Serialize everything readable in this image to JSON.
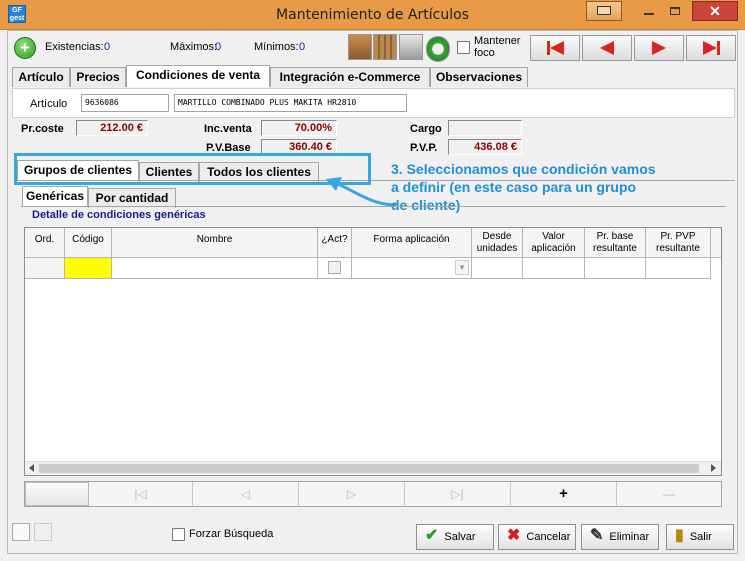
{
  "window": {
    "title": "Mantenimiento de Artículos",
    "app_icon_text": "GF gest",
    "close_symbol": "✕"
  },
  "toolbar": {
    "existencias_label": "Existencias:",
    "existencias_value": "0",
    "maximos_label": "Máximos:",
    "maximos_value": "0",
    "minimos_label": "Mínimos:",
    "minimos_value": "0",
    "mantener_foco_label_1": "Mantener",
    "mantener_foco_label_2": "foco",
    "icons": [
      "add-icon",
      "boxes-icon",
      "shelf-icon",
      "calculator-icon",
      "refresh-icon",
      "first-record-icon",
      "previous-record-icon",
      "next-record-icon",
      "last-record-icon"
    ]
  },
  "main_tabs": [
    "Artículo",
    "Precios",
    "Condiciones de venta",
    "Integración e-Commerce",
    "Observaciones"
  ],
  "active_main_tab": "Condiciones de venta",
  "articulo": {
    "label": "Artículo",
    "code": "9636086",
    "description": "MARTILLO COMBINADO PLUS MAKITA HR2810"
  },
  "prices": {
    "prcoste_label": "Pr.coste",
    "prcoste_value": "212.00 €",
    "incventa_label": "Inc.venta",
    "incventa_value": "70.00%",
    "pvbase_label": "P.V.Base",
    "pvbase_value": "360.40 €",
    "cargo_label": "Cargo",
    "cargo_value": "",
    "pvp_label": "P.V.P.",
    "pvp_value": "436.08 €"
  },
  "condition_tabs": [
    "Grupos de clientes",
    "Clientes",
    "Todos los clientes"
  ],
  "annotation": "3. Seleccionamos que condición vamos a definir (en este caso para un grupo de cliente)",
  "sub_tabs": [
    "Genéricas",
    "Por cantidad"
  ],
  "group_title": "Detalle de condiciones genéricas",
  "grid": {
    "columns": [
      "Ord.",
      "Código",
      "Nombre",
      "¿Act?",
      "Forma aplicación",
      "Desde unidades",
      "Valor aplicación",
      "Pr. base resultante",
      "Pr. PVP resultante"
    ]
  },
  "navigator": {
    "buttons": [
      "first-icon",
      "prior-icon",
      "next-icon",
      "last-icon",
      "insert-icon",
      "delete-icon"
    ],
    "insert_symbol": "+"
  },
  "footer": {
    "forzar_busqueda_label": "Forzar Búsqueda",
    "salvar_label": "Salvar",
    "cancelar_label": "Cancelar",
    "eliminar_label": "Eliminar",
    "salir_label": "Salir"
  },
  "colors": {
    "titlebar": "#e99a46",
    "close_button": "#c7453b",
    "annotation": "#1f8fd6",
    "money_text": "#8b0000",
    "selected_cell": "#ffff00",
    "nav_arrow": "#d8261c"
  }
}
